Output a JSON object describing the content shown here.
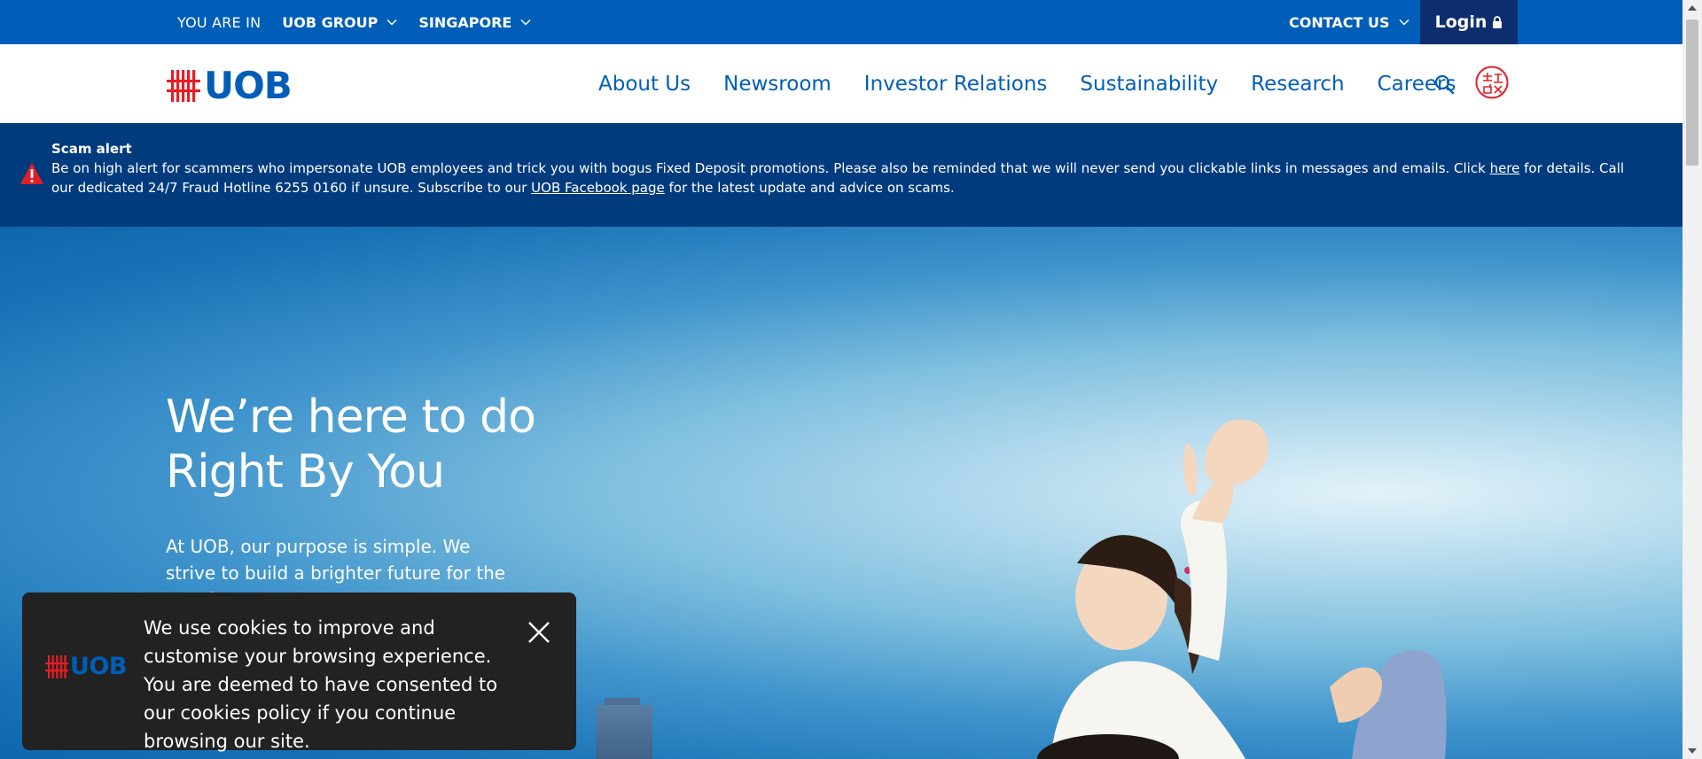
{
  "topbar": {
    "you_are_in": "YOU ARE IN",
    "group_label": "UOB GROUP",
    "country_label": "SINGAPORE",
    "contact_label": "CONTACT US",
    "login_label": "Login"
  },
  "header": {
    "logo_text": "UOB",
    "nav": [
      "About Us",
      "Newsroom",
      "Investor Relations",
      "Sustainability",
      "Research",
      "Careers"
    ]
  },
  "alert": {
    "title": "Scam alert",
    "text_part1": "Be on high alert for scammers who impersonate UOB employees and trick you with bogus Fixed Deposit promotions. Please also be reminded that we will never send you clickable links in messages and emails. Click ",
    "link_here": "here",
    "text_part2": " for details. Call our dedicated 24/7 Fraud Hotline 6255 0160 if unsure. Subscribe to our ",
    "link_facebook": "UOB Facebook page",
    "text_part3": " for the latest update and advice on scams."
  },
  "hero": {
    "heading_line1": "We’re here to do",
    "heading_line2": "Right By You",
    "body": "At UOB, our purpose is simple. We strive to build a brighter future for the people"
  },
  "cookie": {
    "logo_text": "UOB",
    "message": "We use cookies to improve and customise your browsing experience. You are deemed to have consented to our cookies policy if you continue browsing our site."
  },
  "colors": {
    "brand_blue": "#005eb8",
    "login_navy": "#0d2e6e",
    "alert_navy": "#003b7e",
    "brand_red": "#e41e26",
    "cookie_bg": "#222222"
  },
  "icons": {
    "chevron": "chevron-down-icon",
    "lock": "lock-icon",
    "search": "search-icon",
    "language": "language-globe-icon",
    "warning": "warning-icon",
    "close": "close-icon"
  }
}
